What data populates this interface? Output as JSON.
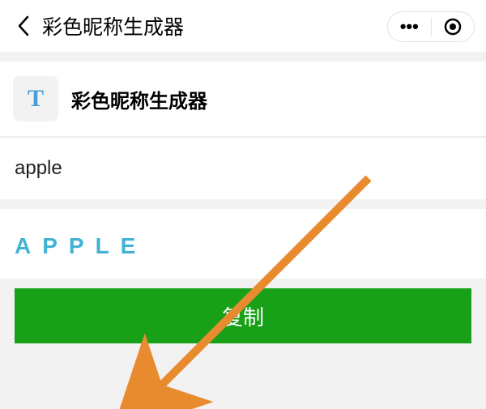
{
  "header": {
    "title": "彩色昵称生成器"
  },
  "app": {
    "icon_letter": "T",
    "name": "彩色昵称生成器"
  },
  "input": {
    "value": "apple"
  },
  "output": {
    "text": "APPLE"
  },
  "actions": {
    "copy_label": "复制"
  }
}
